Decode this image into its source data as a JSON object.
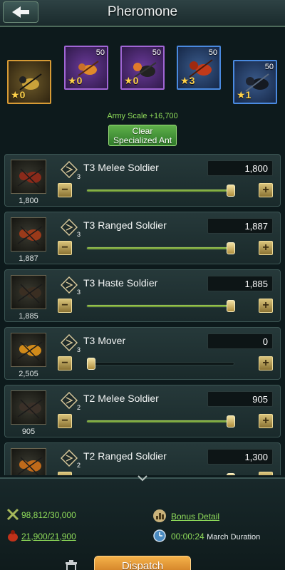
{
  "header": {
    "title": "Pheromone",
    "back_icon": "back-arrow-icon"
  },
  "ant_tiles": [
    {
      "name": "specialized-ant-yellow",
      "count": "",
      "stars": "0",
      "frame": "gold"
    },
    {
      "name": "specialized-ant-orange",
      "count": "50",
      "stars": "0",
      "frame": "purple"
    },
    {
      "name": "specialized-ant-orange-black",
      "count": "50",
      "stars": "0",
      "frame": "purple"
    },
    {
      "name": "specialized-ant-red",
      "count": "50",
      "stars": "3",
      "frame": "blue"
    },
    {
      "name": "specialized-ant-black",
      "count": "50",
      "stars": "1",
      "frame": "blue"
    }
  ],
  "army_scale": "Army Scale +16,700",
  "clear_button": {
    "line1": "Clear",
    "line2": "Specialized Ant"
  },
  "troops": [
    {
      "name": "T3 Melee Soldier",
      "tier": "3",
      "count": "1,800",
      "value": "1,800",
      "level": 1.0
    },
    {
      "name": "T3 Ranged Soldier",
      "tier": "3",
      "count": "1,887",
      "value": "1,887",
      "level": 1.0
    },
    {
      "name": "T3 Haste Soldier",
      "tier": "3",
      "count": "1,885",
      "value": "1,885",
      "level": 1.0
    },
    {
      "name": "T3 Mover",
      "tier": "3",
      "count": "2,505",
      "value": "0",
      "level": 0.0
    },
    {
      "name": "T2 Melee Soldier",
      "tier": "2",
      "count": "905",
      "value": "905",
      "level": 1.0
    },
    {
      "name": "T2 Ranged Soldier",
      "tier": "2",
      "count": "",
      "value": "1,300",
      "level": 1.0
    }
  ],
  "bottom": {
    "power": "98,812/30,000",
    "load": "21,900/21,900",
    "bonus_detail": "Bonus Detail",
    "march_time": "00:00:24",
    "march_label": "March Duration",
    "dispatch": "Dispatch"
  },
  "colors": {
    "accent_green": "#8fdc5a",
    "gold": "#d9c37a",
    "dispatch_orange": "#f5b24a"
  }
}
